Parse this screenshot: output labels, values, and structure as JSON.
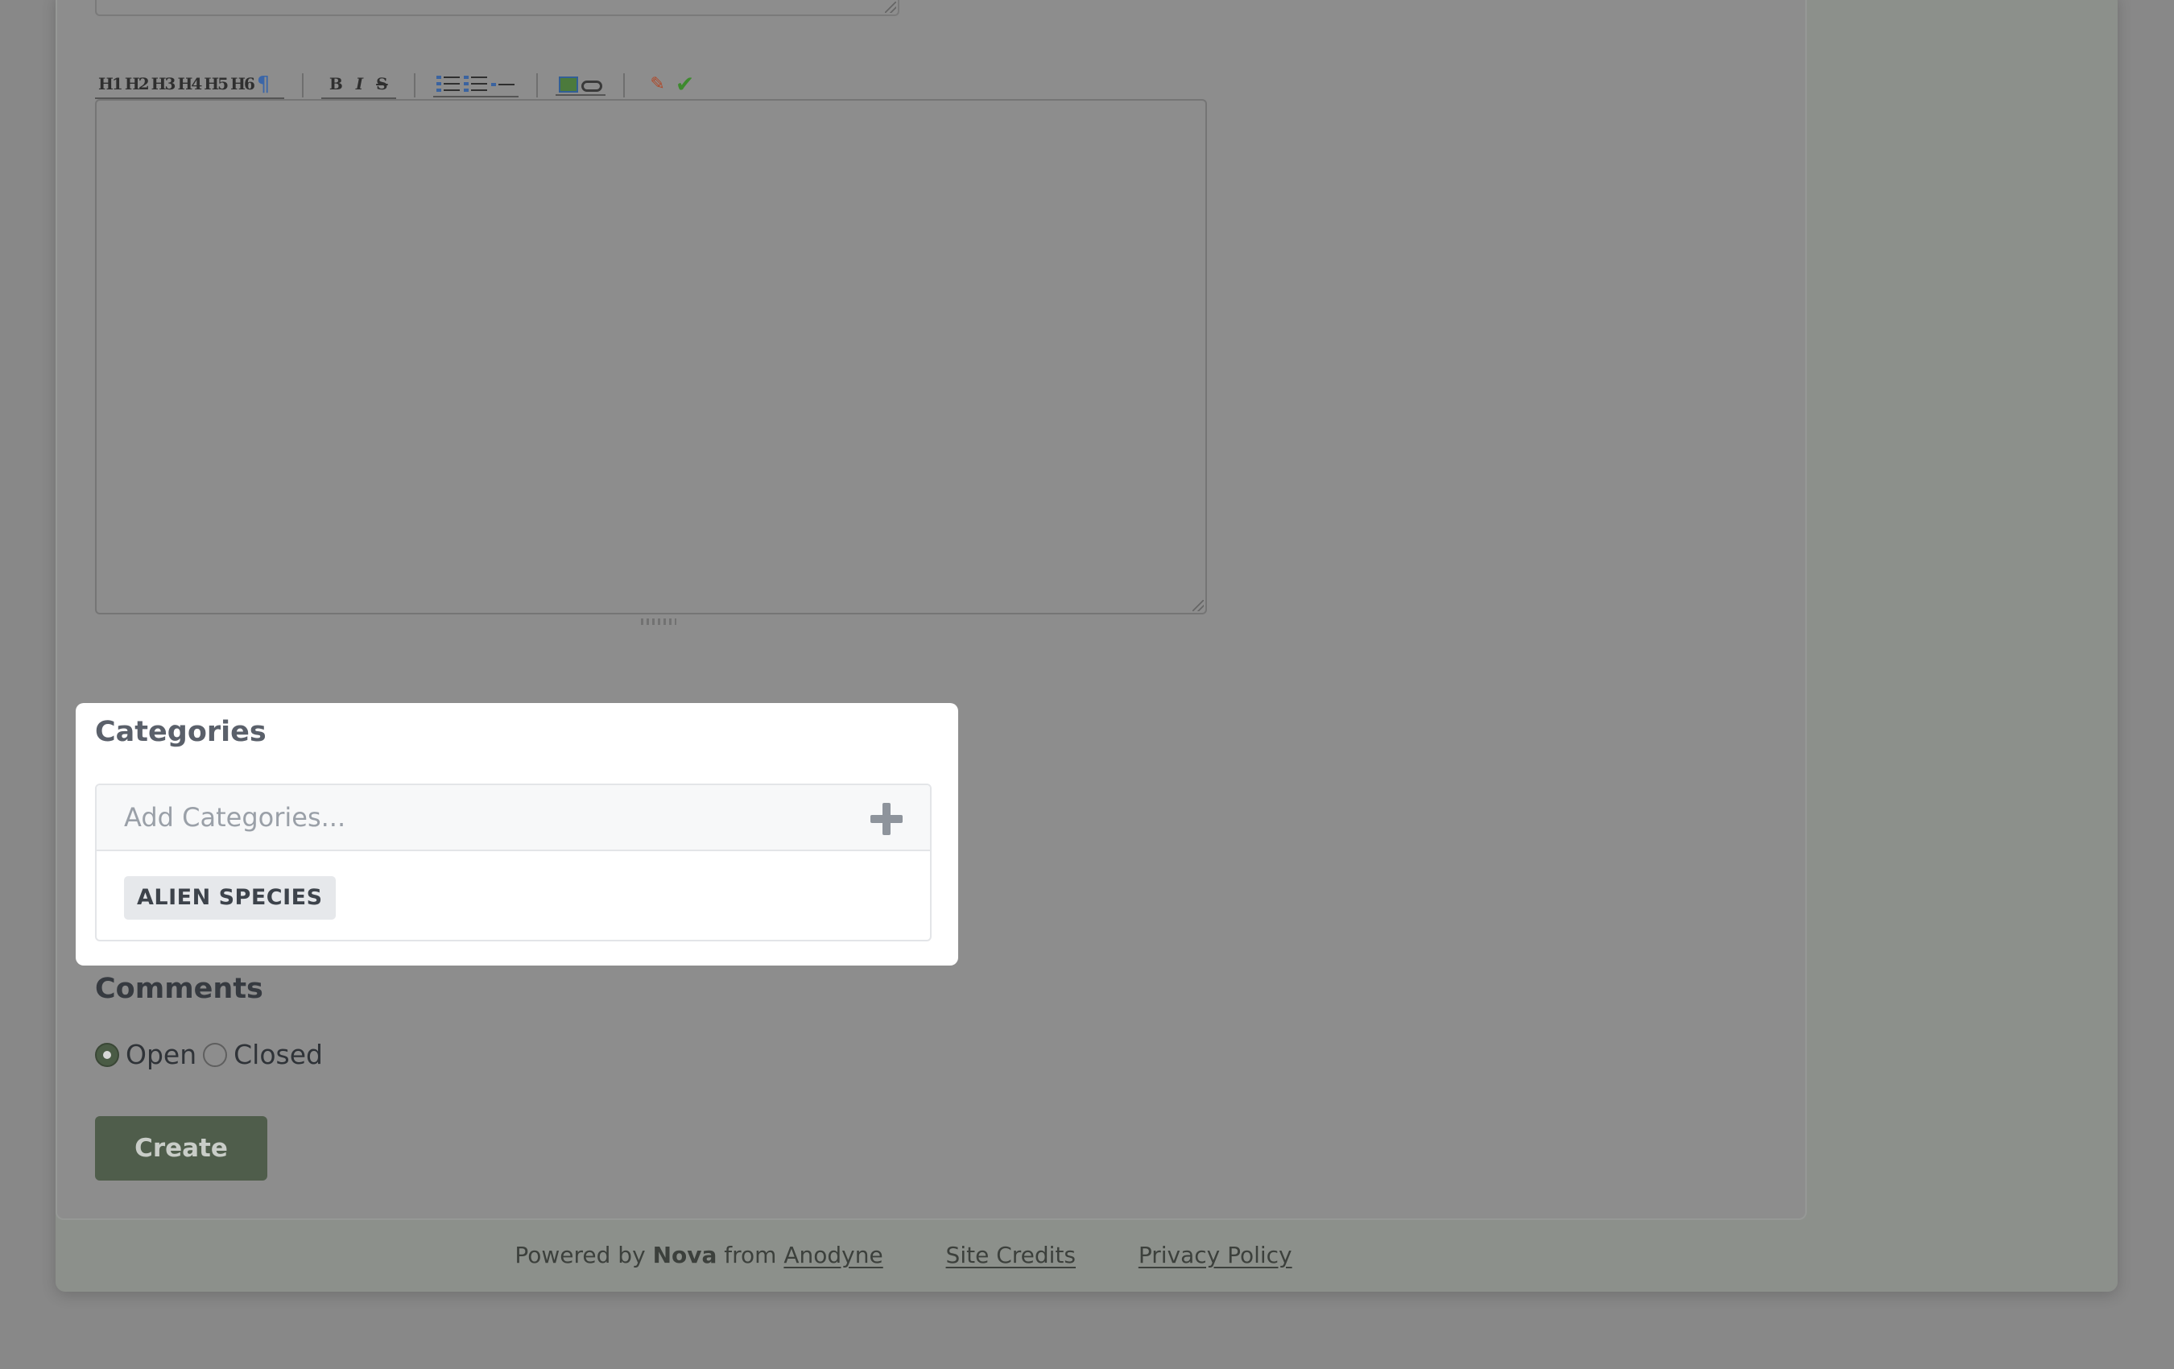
{
  "editor": {
    "toolbar": {
      "headings": [
        "H1",
        "H2",
        "H3",
        "H4",
        "H5",
        "H6"
      ],
      "bold": "B",
      "italic": "I",
      "strike": "S"
    },
    "content": ""
  },
  "categories": {
    "title": "Categories",
    "input_placeholder": "Add Categories...",
    "input_value": "",
    "tags": [
      "ALIEN SPECIES"
    ]
  },
  "comments": {
    "title": "Comments",
    "options": [
      {
        "label": "Open",
        "checked": true
      },
      {
        "label": "Closed",
        "checked": false
      }
    ]
  },
  "actions": {
    "create_label": "Create"
  },
  "footer": {
    "powered_by": "Powered by",
    "brand": "Nova",
    "from": "from",
    "company": "Anodyne",
    "site_credits": "Site Credits",
    "privacy_policy": "Privacy Policy"
  },
  "colors": {
    "accent_green": "#4f5d4b",
    "overlay_gray": "#888888",
    "highlight_white": "#ffffff"
  }
}
